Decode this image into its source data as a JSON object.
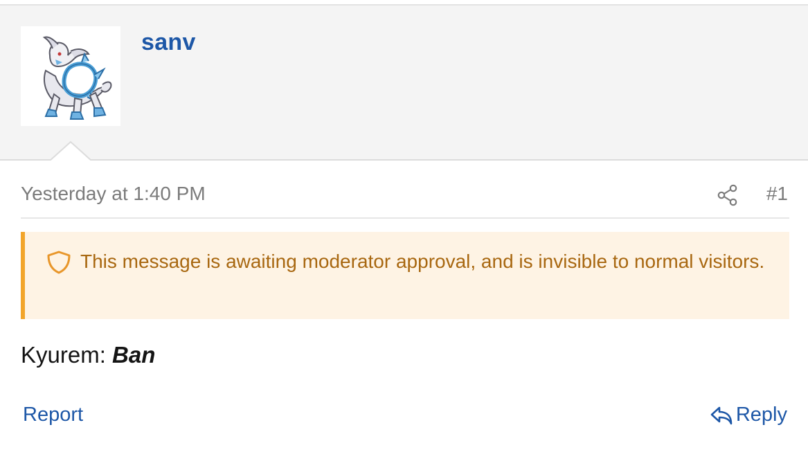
{
  "post": {
    "author": "sanv",
    "timestamp": "Yesterday at 1:40 PM",
    "post_number": "#1",
    "approval_notice": "This message is awaiting moderator approval, and is invisible to normal visitors.",
    "body": {
      "prefix": "Kyurem: ",
      "emphasis": "Ban"
    }
  },
  "actions": {
    "report_label": "Report",
    "reply_label": "Reply"
  },
  "icons": {
    "avatar": "arceus-sprite-avatar",
    "share": "share-icon",
    "shield": "shield-icon",
    "reply": "reply-arrow-icon"
  },
  "colors": {
    "link": "#1d57a7",
    "notice_text": "#a86710",
    "notice_bg": "#fef3e4",
    "notice_border": "#f2a52b",
    "muted_text": "#7b7b7b",
    "header_bg": "#f4f4f4"
  }
}
